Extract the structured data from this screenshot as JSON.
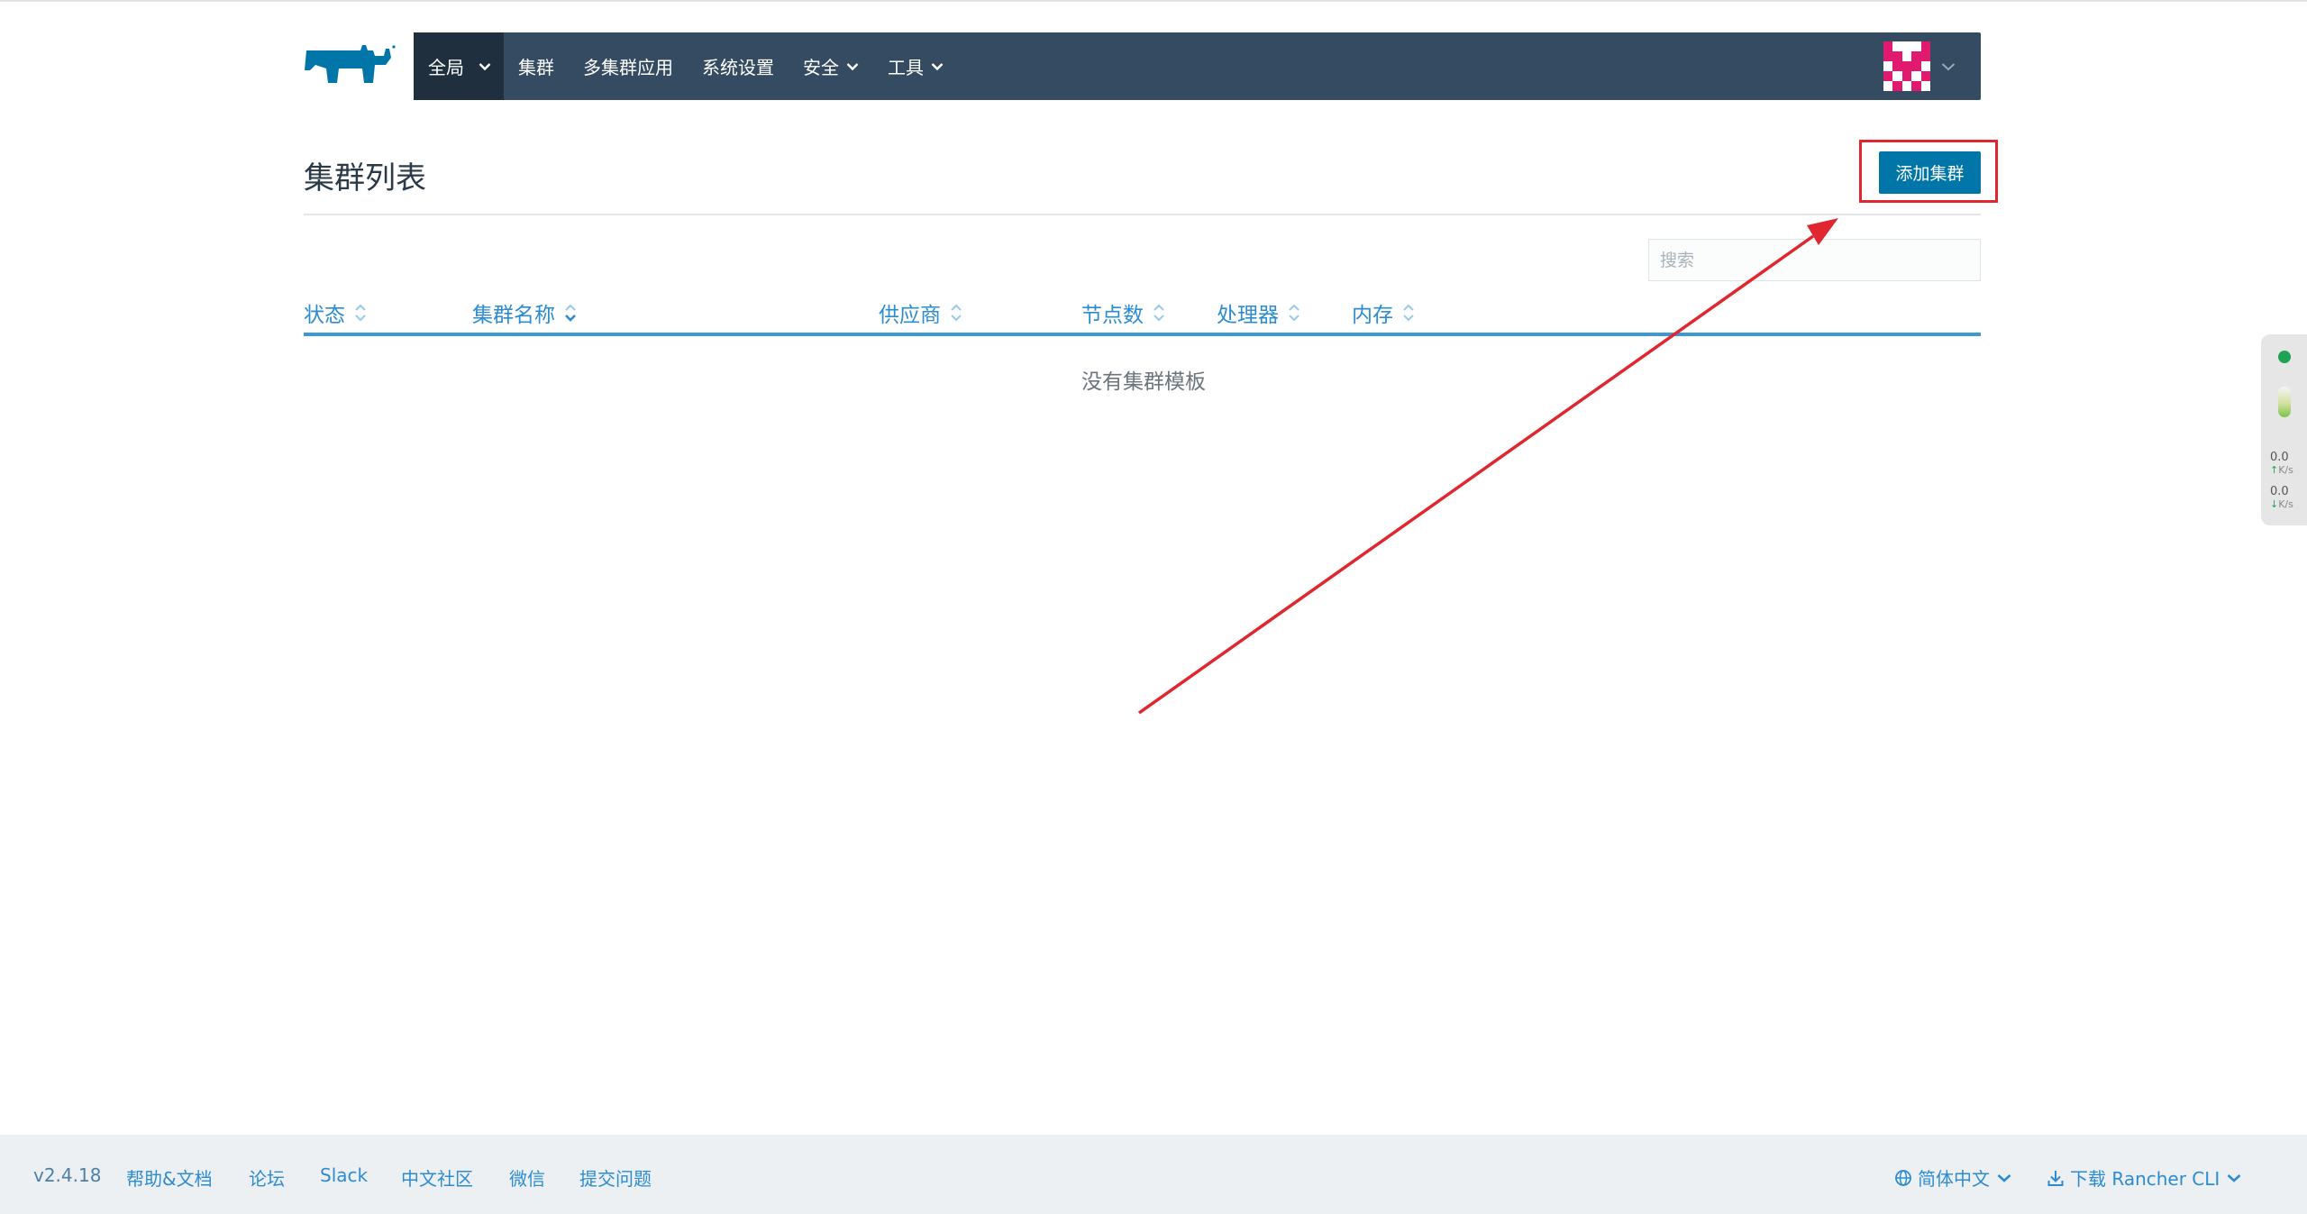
{
  "nav": {
    "global": "全局",
    "clusters": "集群",
    "multi_cluster_apps": "多集群应用",
    "settings": "系统设置",
    "security": "安全",
    "tools": "工具"
  },
  "page": {
    "title": "集群列表",
    "add_button": "添加集群",
    "search_placeholder": "搜索",
    "empty_message": "没有集群模板"
  },
  "table": {
    "columns": [
      "状态",
      "集群名称",
      "供应商",
      "节点数",
      "处理器",
      "内存"
    ],
    "rows": []
  },
  "network_widget": {
    "upload_rate": "0.0",
    "upload_unit": "K/s",
    "download_rate": "0.0",
    "download_unit": "K/s"
  },
  "footer": {
    "version": "v2.4.18",
    "links": [
      "帮助&文档",
      "论坛",
      "Slack",
      "中文社区",
      "微信",
      "提交问题"
    ],
    "language": "简体中文",
    "download_cli": "下载 Rancher CLI"
  },
  "colors": {
    "navbar": "#354b61",
    "navbar_active": "#1f2f3e",
    "primary_button": "#0075a8",
    "link": "#2d8cd0",
    "annotation": "#e0262e"
  },
  "icons": [
    "rancher-logo-icon",
    "chevron-down-icon",
    "avatar-icon",
    "sort-icon",
    "globe-icon",
    "download-icon"
  ]
}
